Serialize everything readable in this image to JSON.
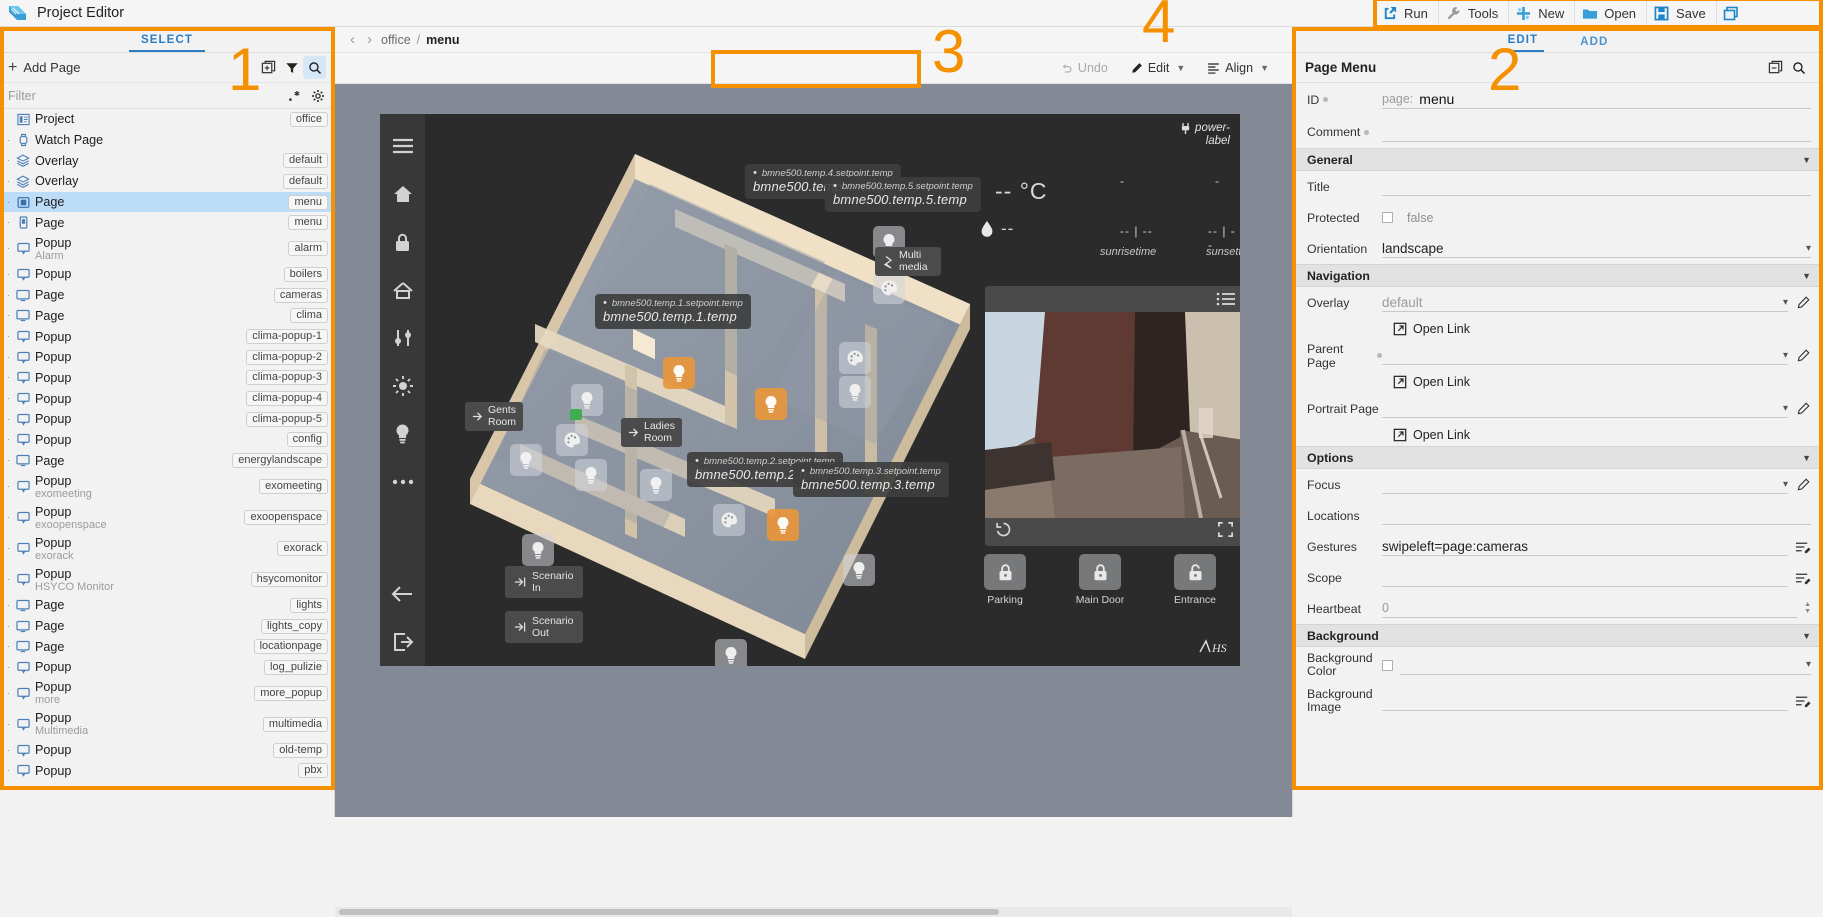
{
  "titlebar": {
    "app_name": "Project Editor"
  },
  "top_tools": [
    {
      "label": "Run",
      "icon": "run-icon"
    },
    {
      "label": "Tools",
      "icon": "wrench-icon"
    },
    {
      "label": "New",
      "icon": "new-icon"
    },
    {
      "label": "Open",
      "icon": "folder-icon"
    },
    {
      "label": "Save",
      "icon": "floppy-icon"
    }
  ],
  "sidebar": {
    "tab_label": "SELECT",
    "add_page_label": "Add Page",
    "filter_placeholder": "Filter",
    "icons": [
      "duplicate-icon",
      "filter-icon",
      "search-icon",
      "regex-icon",
      "gear-icon"
    ],
    "items": [
      {
        "label": "Project",
        "sub": "",
        "tag": "office",
        "icon": "project-icon"
      },
      {
        "label": "Watch Page",
        "sub": "",
        "tag": "",
        "icon": "watch-icon"
      },
      {
        "label": "Overlay",
        "sub": "",
        "tag": "default",
        "icon": "overlay-icon"
      },
      {
        "label": "Overlay",
        "sub": "",
        "tag": "default",
        "icon": "overlay-icon"
      },
      {
        "label": "Page",
        "sub": "",
        "tag": "menu",
        "icon": "page-tablet-icon",
        "selected": true
      },
      {
        "label": "Page",
        "sub": "",
        "tag": "menu",
        "icon": "page-phone-icon"
      },
      {
        "label": "Popup",
        "sub": "Alarm",
        "tag": "alarm",
        "icon": "popup-icon"
      },
      {
        "label": "Popup",
        "sub": "",
        "tag": "boilers",
        "icon": "popup-icon"
      },
      {
        "label": "Page",
        "sub": "",
        "tag": "cameras",
        "icon": "page-icon"
      },
      {
        "label": "Page",
        "sub": "",
        "tag": "clima",
        "icon": "page-icon"
      },
      {
        "label": "Popup",
        "sub": "",
        "tag": "clima-popup-1",
        "icon": "popup-icon"
      },
      {
        "label": "Popup",
        "sub": "",
        "tag": "clima-popup-2",
        "icon": "popup-icon"
      },
      {
        "label": "Popup",
        "sub": "",
        "tag": "clima-popup-3",
        "icon": "popup-icon"
      },
      {
        "label": "Popup",
        "sub": "",
        "tag": "clima-popup-4",
        "icon": "popup-icon"
      },
      {
        "label": "Popup",
        "sub": "",
        "tag": "clima-popup-5",
        "icon": "popup-icon"
      },
      {
        "label": "Popup",
        "sub": "",
        "tag": "config",
        "icon": "popup-icon"
      },
      {
        "label": "Page",
        "sub": "",
        "tag": "energylandscape",
        "icon": "page-icon"
      },
      {
        "label": "Popup",
        "sub": "exomeeting",
        "tag": "exomeeting",
        "icon": "popup-icon"
      },
      {
        "label": "Popup",
        "sub": "exoopenspace",
        "tag": "exoopenspace",
        "icon": "popup-icon"
      },
      {
        "label": "Popup",
        "sub": "exorack",
        "tag": "exorack",
        "icon": "popup-icon"
      },
      {
        "label": "Popup",
        "sub": "HSYCO Monitor",
        "tag": "hsycomonitor",
        "icon": "popup-icon"
      },
      {
        "label": "Page",
        "sub": "",
        "tag": "lights",
        "icon": "page-icon"
      },
      {
        "label": "Page",
        "sub": "",
        "tag": "lights_copy",
        "icon": "page-icon"
      },
      {
        "label": "Page",
        "sub": "",
        "tag": "locationpage",
        "icon": "page-icon"
      },
      {
        "label": "Popup",
        "sub": "",
        "tag": "log_pulizie",
        "icon": "popup-icon"
      },
      {
        "label": "Popup",
        "sub": "more",
        "tag": "more_popup",
        "icon": "popup-icon"
      },
      {
        "label": "Popup",
        "sub": "Multimedia",
        "tag": "multimedia",
        "icon": "popup-icon"
      },
      {
        "label": "Popup",
        "sub": "",
        "tag": "old-temp",
        "icon": "popup-icon"
      },
      {
        "label": "Popup",
        "sub": "",
        "tag": "pbx",
        "icon": "popup-icon"
      }
    ]
  },
  "center": {
    "breadcrumb": {
      "root": "office",
      "separator": "/",
      "current": "menu"
    },
    "toolbar": {
      "undo_label": "Undo",
      "edit_label": "Edit",
      "align_label": "Align"
    },
    "stage": {
      "power_label": "power-\nlabel",
      "temperature": "--  °C",
      "humidity": "--",
      "sunrise_value": "--  |  --",
      "sunset_value": "--  |  --",
      "sunrise_caption": "sunrisetime",
      "sunset_caption": "sunsettime",
      "value_labels": [
        {
          "setpoint": "bmne500.temp.4.setpoint.temp",
          "main": "bmne500.temp.4.temp"
        },
        {
          "setpoint": "bmne500.temp.5.setpoint.temp",
          "main": "bmne500.temp.5.temp"
        },
        {
          "setpoint": "bmne500.temp.1.setpoint.temp",
          "main": "bmne500.temp.1.temp"
        },
        {
          "setpoint": "bmne500.temp.2.setpoint.temp",
          "main": "bmne500.temp.2.temp"
        },
        {
          "setpoint": "bmne500.temp.3.setpoint.temp",
          "main": "bmne500.temp.3.temp"
        }
      ],
      "room_labels": [
        {
          "text": "Gents\nRoom"
        },
        {
          "text": "Ladies\nRoom"
        }
      ],
      "multimedia_label": "Multi\nmedia",
      "scenarios": [
        {
          "text": "Scenario\nIn"
        },
        {
          "text": "Scenario\nOut"
        }
      ],
      "doors": [
        {
          "label": "Parking"
        },
        {
          "label": "Main Door"
        },
        {
          "label": "Entrance"
        }
      ],
      "brand": "HS"
    }
  },
  "right_panel": {
    "tabs": [
      {
        "label": "EDIT",
        "active": true
      },
      {
        "label": "ADD",
        "active": false
      }
    ],
    "title": "Page Menu",
    "header_icons": [
      "collapse-icon",
      "search-icon"
    ],
    "fields": {
      "id_label": "ID",
      "id_prefix": "page:",
      "id_value": "menu",
      "comment_label": "Comment",
      "comment_value": ""
    },
    "sections": [
      {
        "title": "General",
        "rows": [
          {
            "label": "Title",
            "value": "",
            "type": "text"
          },
          {
            "label": "Protected",
            "value": "false",
            "type": "checkbox"
          },
          {
            "label": "Orientation",
            "value": "landscape",
            "type": "select"
          }
        ]
      },
      {
        "title": "Navigation",
        "rows": [
          {
            "label": "Overlay",
            "value": "default",
            "type": "select-pen",
            "placeholder": true,
            "dotted": false
          },
          {
            "label": "Open Link",
            "value": "",
            "type": "link"
          },
          {
            "label": "Parent Page",
            "value": "",
            "type": "select-pen",
            "dotted": true
          },
          {
            "label": "Open Link",
            "value": "",
            "type": "link"
          },
          {
            "label": "Portrait Page",
            "value": "",
            "type": "select-pen"
          },
          {
            "label": "Open Link",
            "value": "",
            "type": "link"
          }
        ]
      },
      {
        "title": "Options",
        "rows": [
          {
            "label": "Focus",
            "value": "",
            "type": "select-pen"
          },
          {
            "label": "Locations",
            "value": "",
            "type": "text"
          },
          {
            "label": "Gestures",
            "value": "swipeleft=page:cameras",
            "type": "text-edit"
          },
          {
            "label": "Scope",
            "value": "",
            "type": "text-edit"
          },
          {
            "label": "Heartbeat",
            "value": "0",
            "type": "spinner"
          }
        ]
      },
      {
        "title": "Background",
        "rows": [
          {
            "label": "Background Color",
            "value": "",
            "type": "color"
          },
          {
            "label": "Background Image",
            "value": "",
            "type": "text-edit"
          }
        ]
      }
    ]
  },
  "annotations": [
    {
      "number": "1",
      "region": "sidebar"
    },
    {
      "number": "2",
      "region": "right-panel"
    },
    {
      "number": "3",
      "region": "edit-toolbar"
    },
    {
      "number": "4",
      "region": "top-tools"
    }
  ],
  "colors": {
    "accent_orange": "#f59000",
    "tab_blue": "#2a7ec4",
    "selection_blue": "#bcdcf7",
    "canvas_gray": "#838a96",
    "stage_dark": "#2b2b2b"
  }
}
